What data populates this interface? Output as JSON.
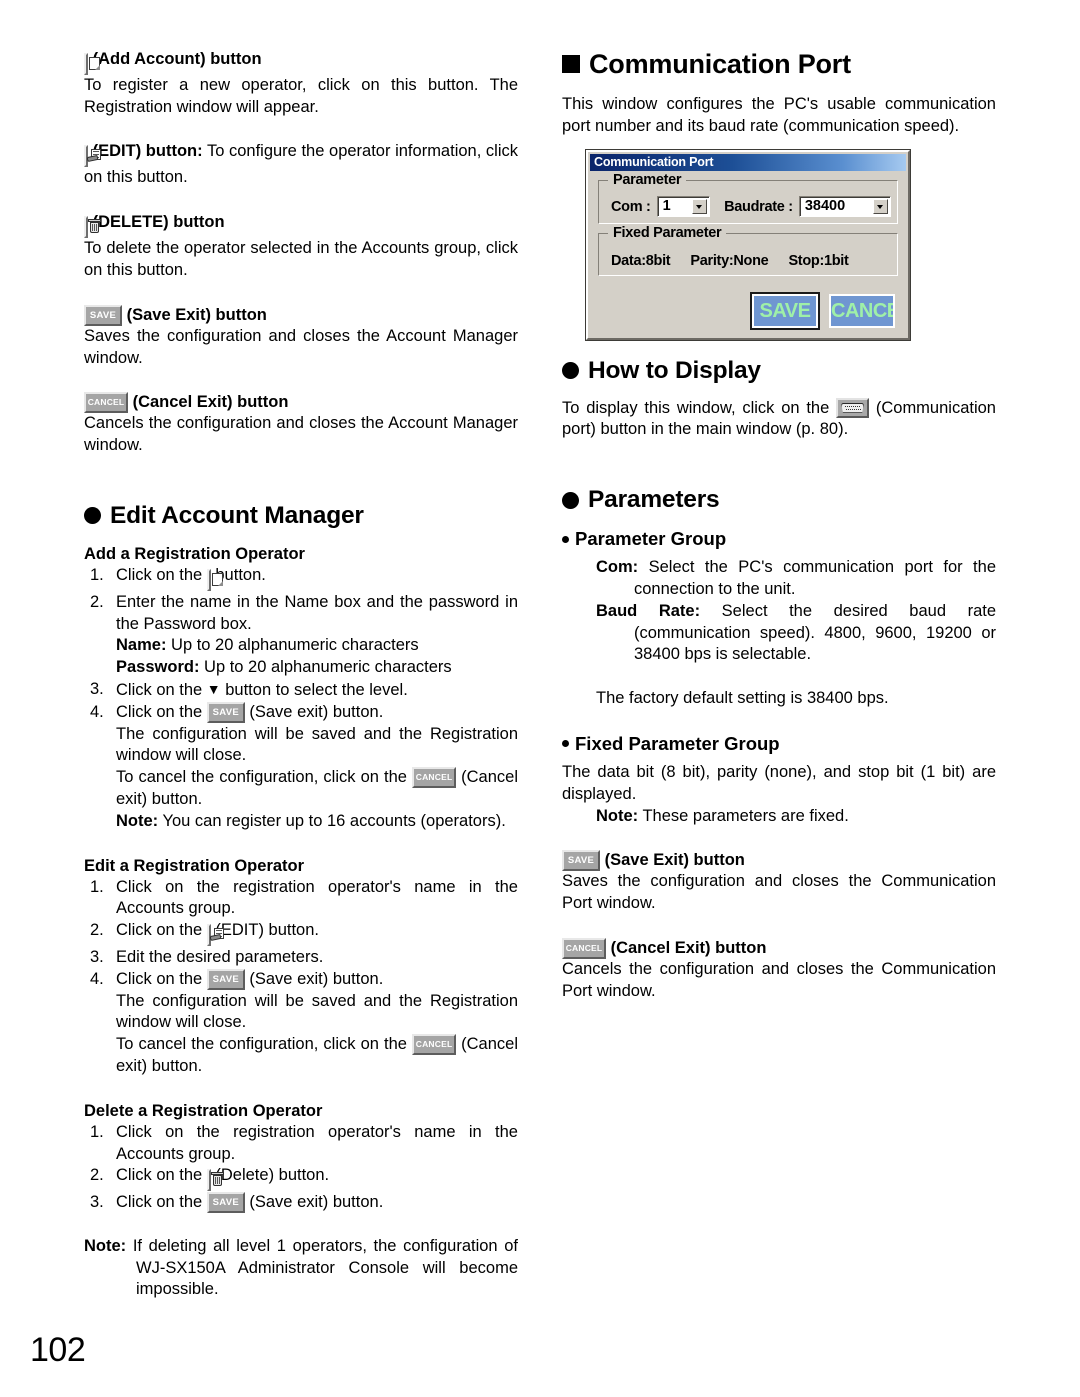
{
  "page": {
    "number": "102"
  },
  "left_column": {
    "add_account": {
      "icon": "add-account-button-icon",
      "heading": "(Add Account) button",
      "body": "To register a new operator, click on this button. The Registration window will appear."
    },
    "edit": {
      "icon": "edit-button-icon",
      "label": "(EDIT) button:",
      "body": " To configure the operator information, click on this button."
    },
    "delete": {
      "icon": "delete-button-icon",
      "heading": "(DELETE) button",
      "body": "To delete the operator selected in the Accounts group, click on this button."
    },
    "save_exit": {
      "icon": "save-button-icon",
      "icon_label": "SAVE",
      "heading": "(Save Exit) button",
      "body": "Saves the configuration and closes the Account Manager window."
    },
    "cancel_exit": {
      "icon": "cancel-button-icon",
      "icon_label": "CANCEL",
      "heading": "(Cancel Exit) button",
      "body": "Cancels the configuration and closes the Account Manager window."
    },
    "edit_account_manager": {
      "heading": "Edit Account Manager",
      "add_operator": {
        "heading": "Add a Registration Operator",
        "step1_a": "Click on the ",
        "step1_b": " button.",
        "step2": "Enter the name in the Name box and the password in the Password box.",
        "step2_name_label": "Name:",
        "step2_name_value": " Up to 20 alphanumeric characters",
        "step2_pass_label": "Password:",
        "step2_pass_value": " Up to 20 alphanumeric characters",
        "step3_a": "Click on the ",
        "step3_tri": "▼",
        "step3_b": " button to select the level.",
        "step4_a": "Click on the ",
        "step4_b": " (Save exit) button.",
        "step4_c": "The configuration will be saved and the Registration window will close.",
        "step4_d": "To cancel the configuration, click on the ",
        "step4_e": " (Cancel exit) button.",
        "note_label": "Note:",
        "note_body": " You can register up to 16 accounts (operators)."
      },
      "edit_operator": {
        "heading": "Edit a Registration Operator",
        "step1": "Click on the registration operator's name in the Accounts group.",
        "step2_a": "Click on the ",
        "step2_b": " (EDIT) button.",
        "step3": "Edit the desired parameters.",
        "step4_a": "Click on the ",
        "step4_b": " (Save exit) button.",
        "step4_c": "The configuration will be saved and the Registration window will close.",
        "step4_d": "To cancel the configuration, click on the ",
        "step4_e": " (Cancel exit) button."
      },
      "delete_operator": {
        "heading": "Delete a Registration Operator",
        "step1": "Click on the registration operator's name in the Accounts group.",
        "step2_a": "Click on the ",
        "step2_b": " (Delete) button.",
        "step3_a": "Click on the ",
        "step3_b": " (Save exit) button."
      },
      "final_note_label": "Note:",
      "final_note_body": " If deleting all level 1 operators, the configuration of WJ-SX150A Administrator Console will become impossible."
    }
  },
  "right_column": {
    "section_title": "Communication Port",
    "intro": "This window configures the PC's usable communication port number and its baud rate (communication speed).",
    "dialog": {
      "title": "Communication Port",
      "parameter_group": {
        "legend": "Parameter",
        "com_label": "Com :",
        "com_value": "1",
        "baudrate_label": "Baudrate :",
        "baudrate_value": "38400"
      },
      "fixed_parameter_group": {
        "legend": "Fixed Parameter",
        "data": "Data:8bit",
        "parity": "Parity:None",
        "stop": "Stop:1bit"
      },
      "save_button": "SAVE",
      "cancel_button": "CANCEL",
      "colors": {
        "titlebar_start": "#0a246a",
        "titlebar_end": "#a6caf0",
        "face": "#d4d0c8",
        "button_blue": "#6f96d1",
        "button_text_green": "#9ff0a8"
      }
    },
    "how_to_display": {
      "heading": "How to Display",
      "body_a": "To display this window, click on the ",
      "icon": "serial-port-button-icon",
      "body_b": " (Communication port) button in the main window (p. 80)."
    },
    "parameters": {
      "heading": "Parameters",
      "parameter_group": {
        "heading": "Parameter Group",
        "com_label": "Com:",
        "com_body": " Select the PC's communication port for the connection to the unit.",
        "baud_label": "Baud Rate:",
        "baud_body": " Select the desired baud rate (communication speed). 4800, 9600, 19200 or 38400 bps is selectable.",
        "factory_default": "The factory default setting is 38400 bps."
      },
      "fixed_parameter_group": {
        "heading": "Fixed Parameter Group",
        "body": "The data bit (8 bit), parity (none), and stop bit (1 bit) are displayed.",
        "note_label": "Note:",
        "note_body": " These parameters are fixed."
      },
      "save_exit": {
        "icon_label": "SAVE",
        "heading": "(Save Exit) button",
        "body": "Saves the configuration and closes the Communication Port window."
      },
      "cancel_exit": {
        "icon_label": "CANCEL",
        "heading": "(Cancel Exit) button",
        "body": "Cancels the configuration and closes the Communication Port window."
      }
    }
  }
}
